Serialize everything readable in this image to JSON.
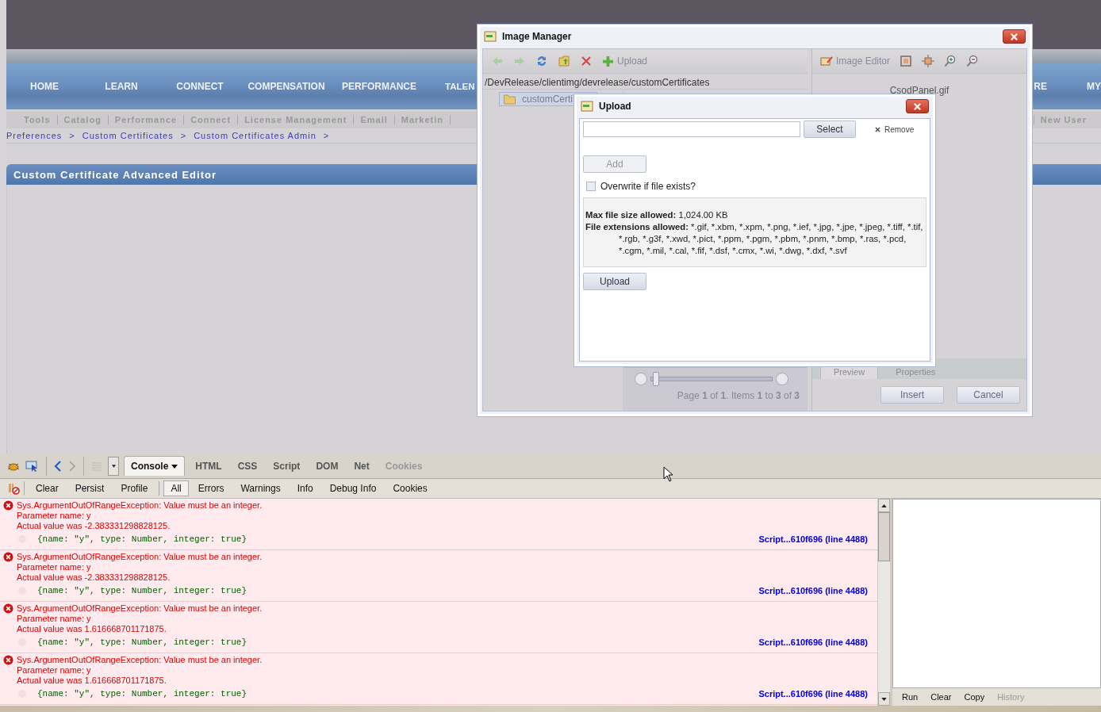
{
  "site": {
    "nav": [
      "HOME",
      "LEARN",
      "CONNECT",
      "COMPENSATION",
      "PERFORMANCE",
      "TALEN"
    ],
    "nav_right": [
      "RE",
      "MY"
    ],
    "subnav": [
      "Tools",
      "Catalog",
      "Performance",
      "Connect",
      "License Management",
      "Email",
      "Marketin"
    ],
    "subnav_right": [
      "New User"
    ],
    "breadcrumbs": [
      {
        "text": "Preferences",
        "separator": ">"
      },
      {
        "text": "Custom Certificates",
        "separator": ">"
      },
      {
        "text": "Custom Certificates Admin",
        "separator": ">"
      }
    ],
    "panel_title": "Custom Certificate Advanced Editor"
  },
  "image_manager": {
    "title": "Image Manager",
    "upload": "Upload",
    "image_editor": "Image Editor",
    "path": "/DevRelease/clientimg/devrelease/customCertificates",
    "folder": "customCerti",
    "file_name": "CsodPanel.gif",
    "tabs": [
      {
        "label": "Preview",
        "selected": true
      },
      {
        "label": "Properties",
        "selected": false
      }
    ],
    "pager_slider": {
      "level": 0
    },
    "pager": "Page **1** of **1**. Items **1** to **3** of **3**",
    "buttons": [
      "Insert",
      "Cancel"
    ]
  },
  "upload": {
    "title": "Upload",
    "select": "Select",
    "remove": "Remove",
    "add": {
      "label": "Add",
      "disabled": true
    },
    "overwrite": {
      "label": "Overwrite if file exists?",
      "checked": false
    },
    "info": [
      {
        "label": "Max file size allowed:",
        "value": "1,024.00 KB"
      },
      {
        "label": "File extensions allowed:",
        "value": "*.gif, *.xbm, *.xpm, *.png, *.ief, *.jpg, *.jpe, *.jpeg, *.tiff, *.tif, *.rgb, *.g3f, *.xwd, *.pict, *.ppm, *.pgm, *.pbm, *.pnm, *.bmp, *.ras, *.pcd, *.cgm, *.mil, *.cal, *.fif, *.dsf, *.cmx, *.wi, *.dwg, *.dxf, *.svf"
      }
    ],
    "upload_button": "Upload"
  },
  "firebug": {
    "tabs": [
      {
        "label": "Console",
        "selected": true,
        "disabled": false
      },
      {
        "label": "HTML",
        "selected": false,
        "disabled": false
      },
      {
        "label": "CSS",
        "selected": false,
        "disabled": false
      },
      {
        "label": "Script",
        "selected": false,
        "disabled": false
      },
      {
        "label": "DOM",
        "selected": false,
        "disabled": false
      },
      {
        "label": "Net",
        "selected": false,
        "disabled": false
      },
      {
        "label": "Cookies",
        "selected": false,
        "disabled": true
      }
    ],
    "actions": [
      "Clear",
      "Persist",
      "Profile"
    ],
    "filters": [
      {
        "label": "All",
        "selected": true
      },
      {
        "label": "Errors",
        "selected": false
      },
      {
        "label": "Warnings",
        "selected": false
      },
      {
        "label": "Info",
        "selected": false
      },
      {
        "label": "Debug Info",
        "selected": false
      },
      {
        "label": "Cookies",
        "selected": false
      }
    ],
    "entries": [
      {
        "message": "Sys.ArgumentOutOfRangeException: Value must be an integer.",
        "parameter": "Parameter name: y",
        "actual": "Actual value was -2.383331298828125.",
        "object": "{name: \"y\", type: Number, integer: true}",
        "source": "Script...610f696 (line 4488)"
      },
      {
        "message": "Sys.ArgumentOutOfRangeException: Value must be an integer.",
        "parameter": "Parameter name: y",
        "actual": "Actual value was -2.383331298828125.",
        "object": "{name: \"y\", type: Number, integer: true}",
        "source": "Script...610f696 (line 4488)"
      },
      {
        "message": "Sys.ArgumentOutOfRangeException: Value must be an integer.",
        "parameter": "Parameter name: y",
        "actual": "Actual value was 1.616668701171875.",
        "object": "{name: \"y\", type: Number, integer: true}",
        "source": "Script...610f696 (line 4488)"
      },
      {
        "message": "Sys.ArgumentOutOfRangeException: Value must be an integer.",
        "parameter": "Parameter name: y",
        "actual": "Actual value was 1.616668701171875.",
        "object": "{name: \"y\", type: Number, integer: true}",
        "source": "Script...610f696 (line 4488)"
      }
    ],
    "command": [
      {
        "label": "Run",
        "disabled": false
      },
      {
        "label": "Clear",
        "disabled": false
      },
      {
        "label": "Copy",
        "disabled": false
      },
      {
        "label": "History",
        "disabled": true
      }
    ]
  }
}
